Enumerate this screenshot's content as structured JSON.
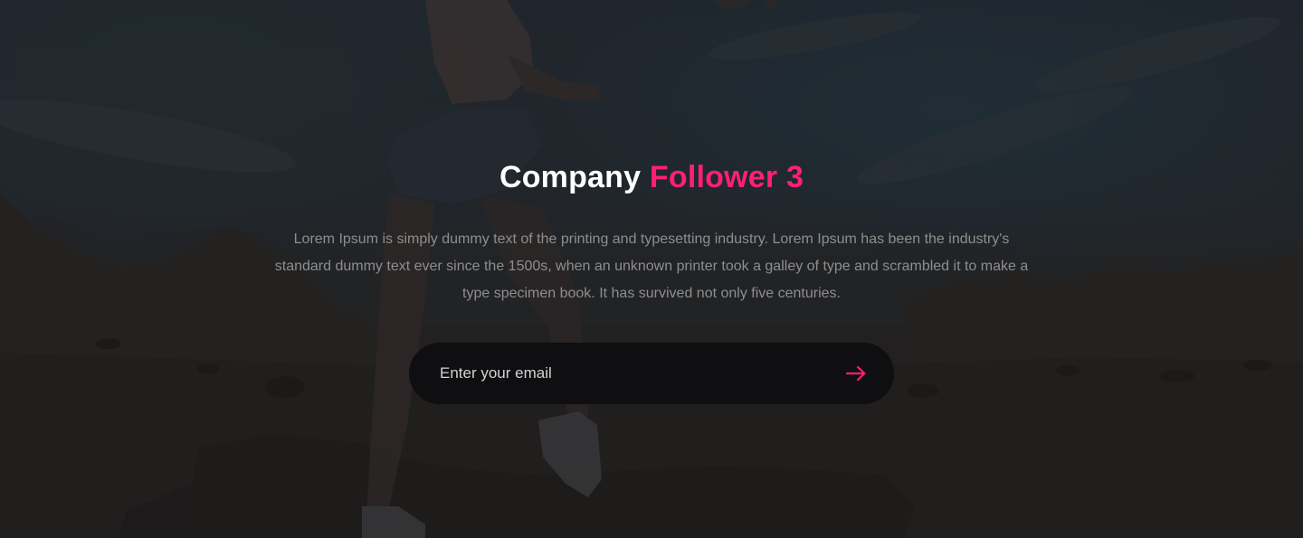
{
  "hero": {
    "title_main": "Company",
    "title_accent": "Follower 3",
    "description": "Lorem Ipsum is simply dummy text of the printing and typesetting industry. Lorem Ipsum has been the industry's standard dummy text ever since the 1500s, when an unknown printer took a galley of type and scrambled it to make a type specimen book. It has survived not only five centuries."
  },
  "subscribe": {
    "placeholder": "Enter your email",
    "value": "",
    "submit_icon": "arrow-right-icon"
  },
  "colors": {
    "accent": "#ff1f74",
    "title": "#ffffff",
    "body_text": "#8e8e8e",
    "input_background": "#0f0e10"
  }
}
